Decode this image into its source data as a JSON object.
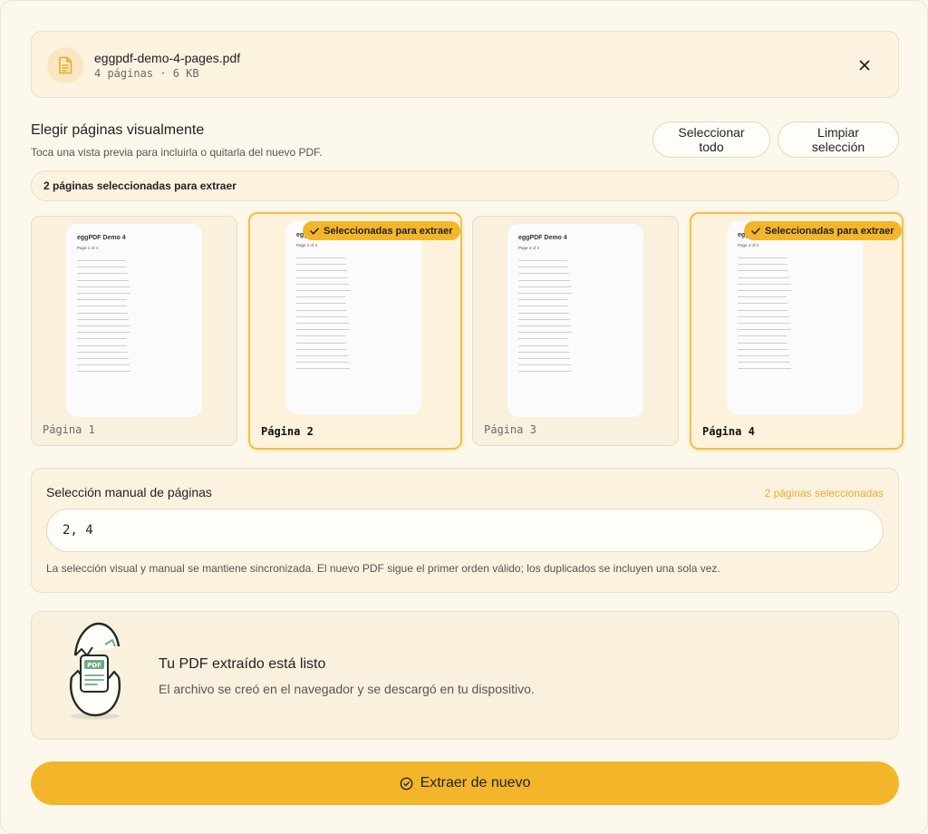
{
  "file": {
    "name": "eggpdf-demo-4-pages.pdf",
    "meta": "4 páginas · 6 KB"
  },
  "visual": {
    "title": "Elegir páginas visualmente",
    "subtitle": "Toca una vista previa para incluirla o quitarla del nuevo PDF.",
    "select_all_label": "Seleccionar todo",
    "clear_label": "Limpiar selección",
    "count_text": "2 páginas seleccionadas para extraer",
    "badge_label": "Seleccionadas para extraer",
    "pages": [
      {
        "label": "Página 1",
        "thumb_title": "eggPDF Demo 4",
        "thumb_sub": "Page 1 of 4",
        "selected": false
      },
      {
        "label": "Página 2",
        "thumb_title": "eggPDF Demo 4",
        "thumb_sub": "Page 2 of 4",
        "selected": true
      },
      {
        "label": "Página 3",
        "thumb_title": "eggPDF Demo 4",
        "thumb_sub": "Page 3 of 4",
        "selected": false
      },
      {
        "label": "Página 4",
        "thumb_title": "eggPDF Demo 4",
        "thumb_sub": "Page 4 of 4",
        "selected": true
      }
    ]
  },
  "manual": {
    "title": "Selección manual de páginas",
    "count": "2 páginas seleccionadas",
    "value": "2, 4",
    "help": "La selección visual y manual se mantiene sincronizada. El nuevo PDF sigue el primer orden válido; los duplicados se incluyen una sola vez."
  },
  "result": {
    "title": "Tu PDF extraído está listo",
    "description": "El archivo se creó en el navegador y se descargó en tu dispositivo.",
    "illustration_text": "PDF"
  },
  "action": {
    "label": "Extraer de nuevo"
  },
  "colors": {
    "accent": "#f3b62a",
    "background": "#fdf8ec",
    "card": "#fcf2e0"
  }
}
